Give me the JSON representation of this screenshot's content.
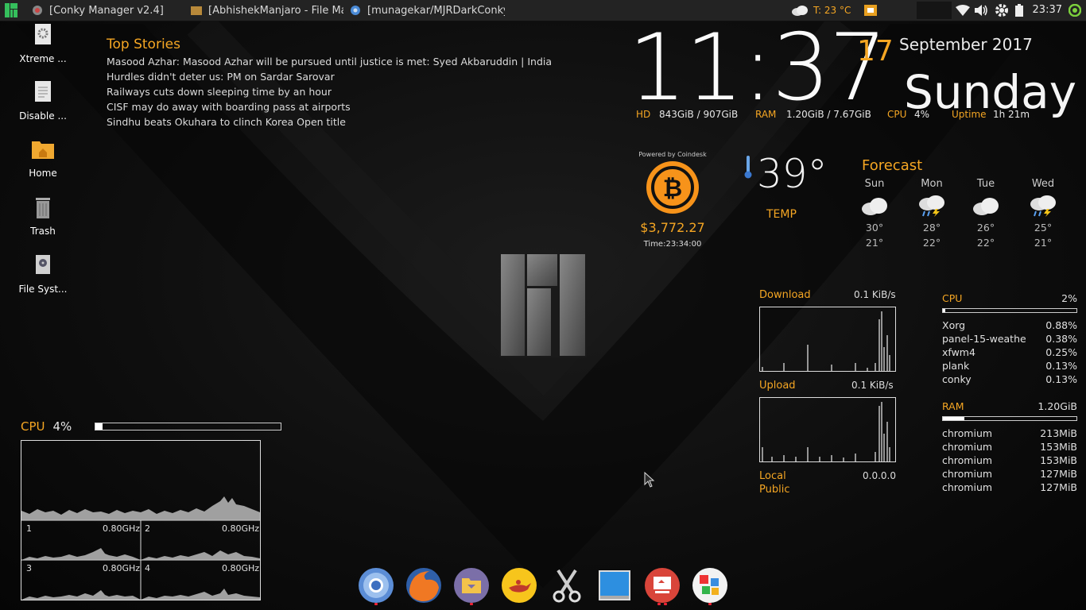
{
  "top_panel": {
    "tasks": [
      {
        "title": "[Conky Manager v2.4]"
      },
      {
        "title": "[AbhishekManjaro - File Ma..."
      },
      {
        "title": "[munagekar/MJRDarkConky:..."
      }
    ],
    "weather_tray": "T: 23 °C",
    "clock": "23:37"
  },
  "desktop_icons": [
    {
      "label": "Xtreme ...",
      "icon": "gear-file-icon"
    },
    {
      "label": "Disable ...",
      "icon": "text-file-icon"
    },
    {
      "label": "Home",
      "icon": "home-folder-icon"
    },
    {
      "label": "Trash",
      "icon": "trash-icon"
    },
    {
      "label": "File Syst...",
      "icon": "drive-icon"
    }
  ],
  "top_stories": {
    "title": "Top Stories",
    "items": [
      "Masood Azhar: Masood Azhar will be pursued until justice is met: Syed Akbaruddin | India Ne",
      "Hurdles didn't deter us: PM on Sardar Sarovar",
      "Railways cuts down sleeping time by an hour",
      "CISF may do away with boarding pass at airports",
      "Sindhu beats Okuhara to clinch Korea Open title"
    ]
  },
  "clock_widget": {
    "time": "11:37",
    "day_num": "17",
    "month_year": "September 2017",
    "weekday": "Sunday",
    "hd_label": "HD",
    "hd_value": "843GiB / 907GiB",
    "ram_label": "RAM",
    "ram_value": "1.20GiB / 7.67GiB",
    "cpu_label": "CPU",
    "cpu_value": "4%",
    "uptime_label": "Uptime",
    "uptime_value": "1h 21m"
  },
  "bitcoin": {
    "powered": "Powered by Coindesk",
    "price": "$3,772.27",
    "time": "Time:23:34:00"
  },
  "temperature": {
    "value": "39°",
    "label": "TEMP"
  },
  "forecast": {
    "title": "Forecast",
    "days": [
      {
        "day": "Sun",
        "hi": "30°",
        "lo": "21°",
        "icon": "cloudy-icon"
      },
      {
        "day": "Mon",
        "hi": "28°",
        "lo": "22°",
        "icon": "thunderstorm-icon"
      },
      {
        "day": "Tue",
        "hi": "26°",
        "lo": "22°",
        "icon": "cloudy-icon"
      },
      {
        "day": "Wed",
        "hi": "25°",
        "lo": "21°",
        "icon": "thunderstorm-icon"
      }
    ]
  },
  "network": {
    "download_label": "Download",
    "download_value": "0.1 KiB/s",
    "upload_label": "Upload",
    "upload_value": "0.1 KiB/s",
    "local_label": "Local",
    "public_label": "Public",
    "ip_value": "0.0.0.0"
  },
  "processes": {
    "cpu_label": "CPU",
    "cpu_value": "2%",
    "cpu_fraction": 0.02,
    "cpu_list": [
      {
        "name": "Xorg",
        "value": "0.88%"
      },
      {
        "name": "panel-15-weathe",
        "value": "0.38%"
      },
      {
        "name": "xfwm4",
        "value": "0.25%"
      },
      {
        "name": "plank",
        "value": "0.13%"
      },
      {
        "name": "conky",
        "value": "0.13%"
      }
    ],
    "ram_label": "RAM",
    "ram_value": "1.20GiB",
    "ram_fraction": 0.16,
    "ram_list": [
      {
        "name": "chromium",
        "value": "213MiB"
      },
      {
        "name": "chromium",
        "value": "153MiB"
      },
      {
        "name": "chromium",
        "value": "153MiB"
      },
      {
        "name": "chromium",
        "value": "127MiB"
      },
      {
        "name": "chromium",
        "value": "127MiB"
      }
    ]
  },
  "cpu_widget": {
    "label": "CPU",
    "value": "4%",
    "fraction": 0.04,
    "cores": [
      {
        "num": "1",
        "freq": "0.80GHz"
      },
      {
        "num": "2",
        "freq": "0.80GHz"
      },
      {
        "num": "3",
        "freq": "0.80GHz"
      },
      {
        "num": "4",
        "freq": "0.80GHz"
      }
    ]
  },
  "dock": [
    {
      "name": "chromium",
      "running": true
    },
    {
      "name": "firefox",
      "running": false
    },
    {
      "name": "file-manager",
      "running": true
    },
    {
      "name": "genie",
      "running": false
    },
    {
      "name": "screenshot",
      "running": false
    },
    {
      "name": "desktop",
      "running": false
    },
    {
      "name": "presentation",
      "running": true
    },
    {
      "name": "software-center",
      "running": true
    }
  ],
  "colors": {
    "accent": "#f5a623",
    "panel": "#232323"
  }
}
